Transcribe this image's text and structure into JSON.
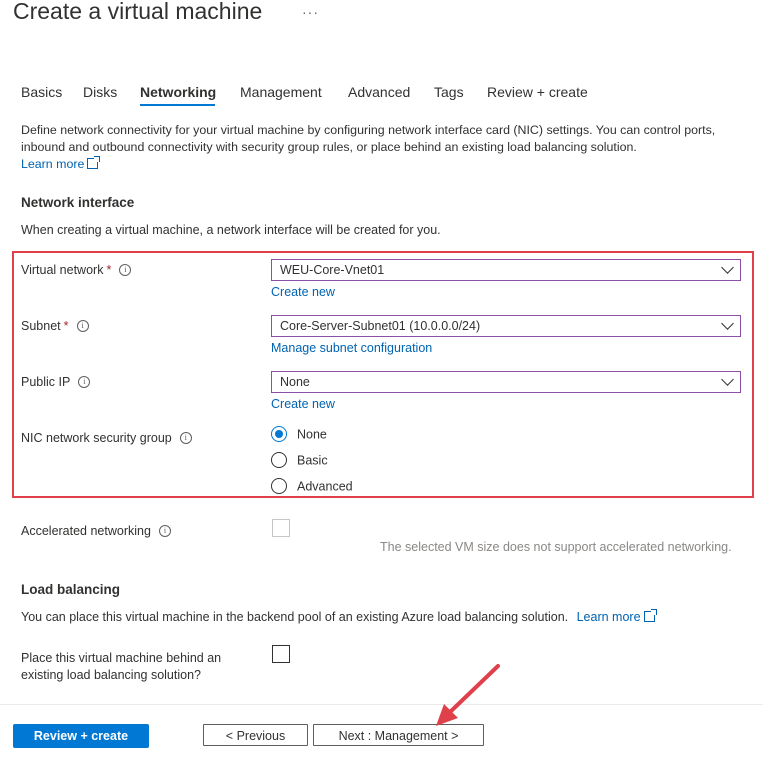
{
  "header": {
    "title": "Create a virtual machine",
    "more_label": "···"
  },
  "tabs": [
    {
      "label": "Basics"
    },
    {
      "label": "Disks"
    },
    {
      "label": "Networking"
    },
    {
      "label": "Management"
    },
    {
      "label": "Advanced"
    },
    {
      "label": "Tags"
    },
    {
      "label": "Review + create"
    }
  ],
  "active_tab": "Networking",
  "intro": {
    "text": "Define network connectivity for your virtual machine by configuring network interface card (NIC) settings. You can control ports, inbound and outbound connectivity with security group rules, or place behind an existing load balancing solution.",
    "learn_more": "Learn more"
  },
  "network_interface": {
    "title": "Network interface",
    "description": "When creating a virtual machine, a network interface will be created for you.",
    "virtual_network": {
      "label": "Virtual network",
      "value": "WEU-Core-Vnet01",
      "link": "Create new"
    },
    "subnet": {
      "label": "Subnet",
      "value": "Core-Server-Subnet01 (10.0.0.0/24)",
      "link": "Manage subnet configuration"
    },
    "public_ip": {
      "label": "Public IP",
      "value": "None",
      "link": "Create new"
    },
    "nic_nsg": {
      "label": "NIC network security group",
      "options": [
        "None",
        "Basic",
        "Advanced"
      ],
      "selected": "None"
    },
    "required_mark": "*",
    "info_glyph": "i"
  },
  "accelerated_networking": {
    "label": "Accelerated networking",
    "checked": false,
    "disabled": true,
    "note": "The selected VM size does not support accelerated networking."
  },
  "load_balancing": {
    "title": "Load balancing",
    "description": "You can place this virtual machine in the backend pool of an existing Azure load balancing solution.",
    "learn_more": "Learn more",
    "option_label_line1": "Place this virtual machine behind an",
    "option_label_line2": "existing load balancing solution?",
    "checked": false
  },
  "footer": {
    "review_create": "Review + create",
    "previous": "< Previous",
    "next": "Next : Management >"
  },
  "colors": {
    "accent": "#0078d4",
    "highlight_box": "#e0404a",
    "link": "#0063b1"
  }
}
